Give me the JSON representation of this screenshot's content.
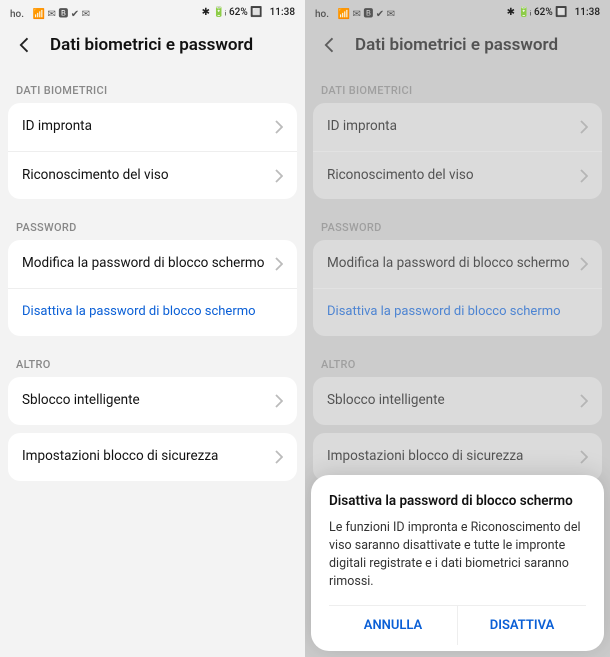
{
  "status": {
    "carrier": "ho.",
    "icons": "✉",
    "battery": "62%",
    "time": "11:38"
  },
  "header": {
    "title": "Dati biometrici e password"
  },
  "sections": {
    "biometrics": {
      "label": "DATI BIOMETRICI",
      "rows": [
        {
          "label": "ID impronta"
        },
        {
          "label": "Riconoscimento del viso"
        }
      ]
    },
    "password": {
      "label": "PASSWORD",
      "rows": [
        {
          "label": "Modifica la password di blocco schermo"
        },
        {
          "label_link": "Disattiva la password di blocco schermo"
        }
      ]
    },
    "other": {
      "label": "ALTRO",
      "rows": [
        {
          "label": "Sblocco intelligente"
        }
      ],
      "rows2": [
        {
          "label": "Impostazioni blocco di sicurezza"
        }
      ]
    }
  },
  "dialog": {
    "title": "Disattiva la password di blocco schermo",
    "body": "Le funzioni ID impronta e Riconoscimento del viso saranno disattivate e tutte le impronte digitali registrate e i dati biometrici saranno rimossi.",
    "cancel": "ANNULLA",
    "confirm": "DISATTIVA"
  }
}
